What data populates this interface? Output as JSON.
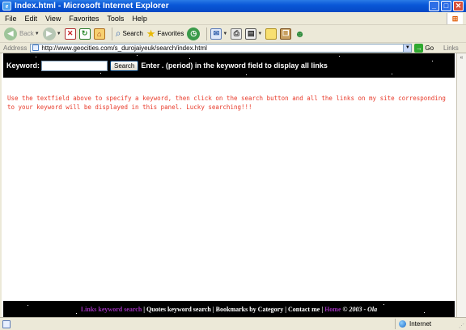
{
  "window": {
    "title": "Index.html - Microsoft Internet Explorer",
    "app_icon": "e",
    "controls": {
      "minimize": "_",
      "maximize": "□",
      "close": "✕"
    }
  },
  "menu": {
    "items": [
      {
        "first": "F",
        "rest": "ile"
      },
      {
        "first": "E",
        "rest": "dit"
      },
      {
        "first": "V",
        "rest": "iew"
      },
      {
        "first": "",
        "rest": "Favorites",
        "mid": "a"
      },
      {
        "first": "T",
        "rest": "ools"
      },
      {
        "first": "H",
        "rest": "elp"
      }
    ],
    "labels": [
      "File",
      "Edit",
      "View",
      "Favorites",
      "Tools",
      "Help"
    ]
  },
  "toolbar": {
    "back_label": "Back",
    "search_label": "Search",
    "favorites_label": "Favorites"
  },
  "address": {
    "label": "Address",
    "url": "http://www.geocities.com/s_durojaiyeuk/search/index.html",
    "go_label": "Go",
    "links_label": "Links"
  },
  "page": {
    "keyword_label": "Keyword:",
    "keyword_value": "",
    "search_button": "Search",
    "hint": "Enter . (period) in the keyword field to display all links",
    "instructions": "Use the textfield above to specify a keyword, then click on the search button and all the links on my site corresponding to your keyword will be displayed in this panel. Lucky searching!!!",
    "footer": {
      "link1": "Links keyword search",
      "sep1": " | ",
      "link2": "Quotes keyword search",
      "sep2": " | ",
      "link3": "Bookmarks by Category",
      "sep3": " | ",
      "link4": "Contact me",
      "sep4": " | ",
      "link5": "Home",
      "copyright": " © 2003 - ",
      "author": "Ola"
    }
  },
  "status": {
    "zone": "Internet"
  },
  "colors": {
    "instruction_text": "#e83a2a",
    "footer_purple": "#9b2fb8",
    "header_bg": "#000000"
  }
}
